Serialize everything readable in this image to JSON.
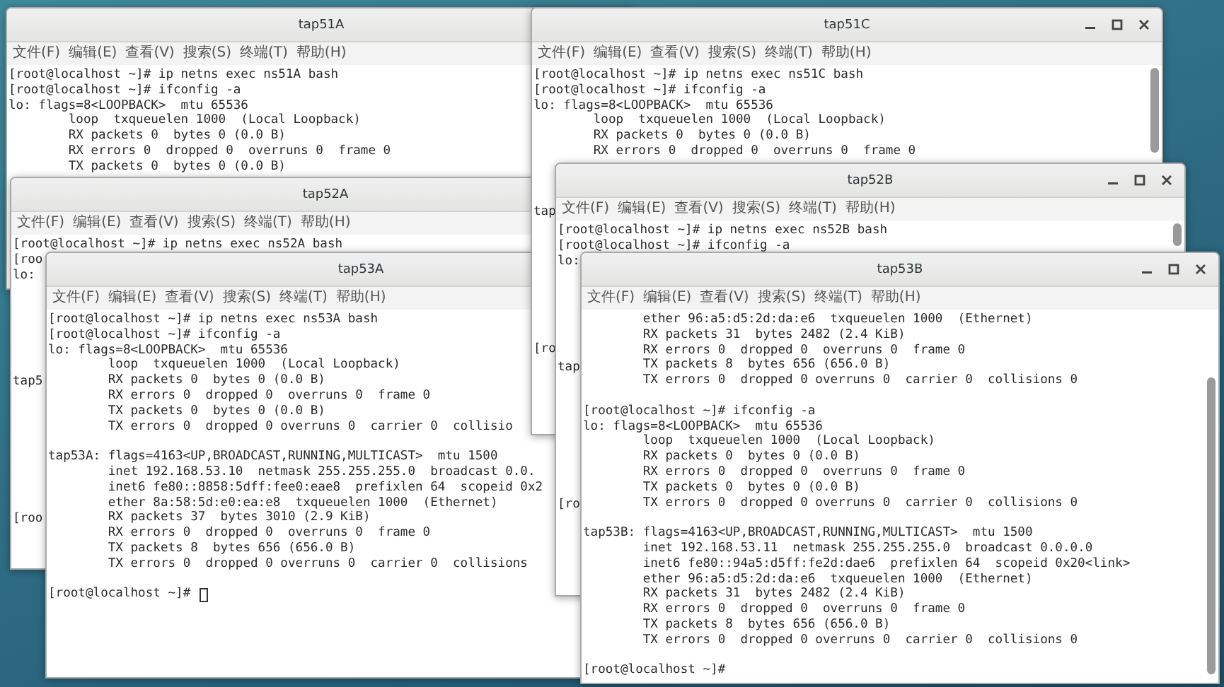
{
  "desktop": {
    "windows": [
      {
        "title": "tap51A",
        "menu": [
          "文件(F)",
          "编辑(E)",
          "查看(V)",
          "搜索(S)",
          "终端(T)",
          "帮助(H)"
        ],
        "lines": [
          {
            "kind": "text",
            "text": "[root@localhost ~]# ip netns exec ns51A bash"
          },
          {
            "kind": "text",
            "text": "[root@localhost ~]# ifconfig -a"
          },
          {
            "kind": "text",
            "text": "lo: flags=8<LOOPBACK>  mtu 65536"
          },
          {
            "kind": "text",
            "text": "        loop  txqueuelen 1000  (Local Loopback)"
          },
          {
            "kind": "text",
            "text": "        RX packets 0  bytes 0 (0.0 B)"
          },
          {
            "kind": "text",
            "text": "        RX errors 0  dropped 0  overruns 0  frame 0"
          },
          {
            "kind": "text",
            "text": "        TX packets 0  bytes 0 (0.0 B)"
          }
        ]
      },
      {
        "title": "tap51C",
        "window_buttons": true,
        "menu": [
          "文件(F)",
          "编辑(E)",
          "查看(V)",
          "搜索(S)",
          "终端(T)",
          "帮助(H)"
        ],
        "lines": [
          {
            "kind": "text",
            "text": "[root@localhost ~]# ip netns exec ns51C bash"
          },
          {
            "kind": "text",
            "text": "[root@localhost ~]# ifconfig -a"
          },
          {
            "kind": "text",
            "text": "lo: flags=8<LOOPBACK>  mtu 65536"
          },
          {
            "kind": "text",
            "text": "        loop  txqueuelen 1000  (Local Loopback)"
          },
          {
            "kind": "text",
            "text": "        RX packets 0  bytes 0 (0.0 B)"
          },
          {
            "kind": "text",
            "text": "        RX errors 0  dropped 0  overruns 0  frame 0"
          },
          {
            "kind": "blank"
          },
          {
            "kind": "blank"
          },
          {
            "kind": "blank"
          },
          {
            "kind": "text",
            "text": "tap"
          },
          {
            "kind": "blank"
          },
          {
            "kind": "blank"
          },
          {
            "kind": "blank"
          },
          {
            "kind": "blank"
          },
          {
            "kind": "blank"
          },
          {
            "kind": "blank"
          },
          {
            "kind": "blank"
          },
          {
            "kind": "blank"
          },
          {
            "kind": "text",
            "text": "[ro"
          }
        ]
      },
      {
        "title": "tap52A",
        "menu": [
          "文件(F)",
          "编辑(E)",
          "查看(V)",
          "搜索(S)",
          "终端(T)",
          "帮助(H)"
        ],
        "lines": [
          {
            "kind": "text",
            "text": "[root@localhost ~]# ip netns exec ns52A bash"
          },
          {
            "kind": "text",
            "text": "[roo"
          },
          {
            "kind": "text",
            "text": "lo:"
          },
          {
            "kind": "blank"
          },
          {
            "kind": "blank"
          },
          {
            "kind": "blank"
          },
          {
            "kind": "blank"
          },
          {
            "kind": "blank"
          },
          {
            "kind": "blank"
          },
          {
            "kind": "text",
            "text": "tap5"
          },
          {
            "kind": "blank"
          },
          {
            "kind": "blank"
          },
          {
            "kind": "blank"
          },
          {
            "kind": "blank"
          },
          {
            "kind": "blank"
          },
          {
            "kind": "blank"
          },
          {
            "kind": "blank"
          },
          {
            "kind": "blank"
          },
          {
            "kind": "text",
            "text": "[roo"
          }
        ]
      },
      {
        "title": "tap52B",
        "window_buttons": true,
        "menu": [
          "文件(F)",
          "编辑(E)",
          "查看(V)",
          "搜索(S)",
          "终端(T)",
          "帮助(H)"
        ],
        "lines": [
          {
            "kind": "text",
            "text": "[root@localhost ~]# ip netns exec ns52B bash"
          },
          {
            "kind": "text",
            "text": "[root@localhost ~]# ifconfig -a"
          },
          {
            "kind": "text",
            "text": "lo:"
          },
          {
            "kind": "blank"
          },
          {
            "kind": "blank"
          },
          {
            "kind": "blank"
          },
          {
            "kind": "blank"
          },
          {
            "kind": "blank"
          },
          {
            "kind": "blank"
          },
          {
            "kind": "text",
            "text": "tap"
          },
          {
            "kind": "blank"
          },
          {
            "kind": "blank"
          },
          {
            "kind": "blank"
          },
          {
            "kind": "blank"
          },
          {
            "kind": "blank"
          },
          {
            "kind": "blank"
          },
          {
            "kind": "blank"
          },
          {
            "kind": "blank"
          },
          {
            "kind": "text",
            "text": "[ro"
          }
        ]
      },
      {
        "title": "tap53A",
        "cursor": true,
        "menu": [
          "文件(F)",
          "编辑(E)",
          "查看(V)",
          "搜索(S)",
          "终端(T)",
          "帮助(H)"
        ],
        "lines": [
          {
            "kind": "text",
            "text": "[root@localhost ~]# ip netns exec ns53A bash"
          },
          {
            "kind": "text",
            "text": "[root@localhost ~]# ifconfig -a"
          },
          {
            "kind": "text",
            "text": "lo: flags=8<LOOPBACK>  mtu 65536"
          },
          {
            "kind": "text",
            "text": "        loop  txqueuelen 1000  (Local Loopback)"
          },
          {
            "kind": "text",
            "text": "        RX packets 0  bytes 0 (0.0 B)"
          },
          {
            "kind": "text",
            "text": "        RX errors 0  dropped 0  overruns 0  frame 0"
          },
          {
            "kind": "text",
            "text": "        TX packets 0  bytes 0 (0.0 B)"
          },
          {
            "kind": "text",
            "text": "        TX errors 0  dropped 0 overruns 0  carrier 0  collisio"
          },
          {
            "kind": "blank"
          },
          {
            "kind": "text",
            "text": "tap53A: flags=4163<UP,BROADCAST,RUNNING,MULTICAST>  mtu 1500"
          },
          {
            "kind": "text",
            "text": "        inet 192.168.53.10  netmask 255.255.255.0  broadcast 0.0."
          },
          {
            "kind": "text",
            "text": "        inet6 fe80::8858:5dff:fee0:eae8  prefixlen 64  scopeid 0x2"
          },
          {
            "kind": "text",
            "text": "        ether 8a:58:5d:e0:ea:e8  txqueuelen 1000  (Ethernet)"
          },
          {
            "kind": "text",
            "text": "        RX packets 37  bytes 3010 (2.9 KiB)"
          },
          {
            "kind": "text",
            "text": "        RX errors 0  dropped 0  overruns 0  frame 0"
          },
          {
            "kind": "text",
            "text": "        TX packets 8  bytes 656 (656.0 B)"
          },
          {
            "kind": "text",
            "text": "        TX errors 0  dropped 0 overruns 0  carrier 0  collisions"
          },
          {
            "kind": "blank"
          },
          {
            "kind": "text",
            "text": "[root@localhost ~]#"
          }
        ]
      },
      {
        "title": "tap53B",
        "window_buttons": true,
        "menu": [
          "文件(F)",
          "编辑(E)",
          "查看(V)",
          "搜索(S)",
          "终端(T)",
          "帮助(H)"
        ],
        "lines": [
          {
            "kind": "text",
            "text": "        ether 96:a5:d5:2d:da:e6  txqueuelen 1000  (Ethernet)"
          },
          {
            "kind": "text",
            "text": "        RX packets 31  bytes 2482 (2.4 KiB)"
          },
          {
            "kind": "text",
            "text": "        RX errors 0  dropped 0  overruns 0  frame 0"
          },
          {
            "kind": "text",
            "text": "        TX packets 8  bytes 656 (656.0 B)"
          },
          {
            "kind": "text",
            "text": "        TX errors 0  dropped 0 overruns 0  carrier 0  collisions 0"
          },
          {
            "kind": "blank"
          },
          {
            "kind": "text",
            "text": "[root@localhost ~]# ifconfig -a"
          },
          {
            "kind": "text",
            "text": "lo: flags=8<LOOPBACK>  mtu 65536"
          },
          {
            "kind": "text",
            "text": "        loop  txqueuelen 1000  (Local Loopback)"
          },
          {
            "kind": "text",
            "text": "        RX packets 0  bytes 0 (0.0 B)"
          },
          {
            "kind": "text",
            "text": "        RX errors 0  dropped 0  overruns 0  frame 0"
          },
          {
            "kind": "text",
            "text": "        TX packets 0  bytes 0 (0.0 B)"
          },
          {
            "kind": "text",
            "text": "        TX errors 0  dropped 0 overruns 0  carrier 0  collisions 0"
          },
          {
            "kind": "blank"
          },
          {
            "kind": "text",
            "text": "tap53B: flags=4163<UP,BROADCAST,RUNNING,MULTICAST>  mtu 1500"
          },
          {
            "kind": "text",
            "text": "        inet 192.168.53.11  netmask 255.255.255.0  broadcast 0.0.0.0"
          },
          {
            "kind": "text",
            "text": "        inet6 fe80::94a5:d5ff:fe2d:dae6  prefixlen 64  scopeid 0x20<link>"
          },
          {
            "kind": "text",
            "text": "        ether 96:a5:d5:2d:da:e6  txqueuelen 1000  (Ethernet)"
          },
          {
            "kind": "text",
            "text": "        RX packets 31  bytes 2482 (2.4 KiB)"
          },
          {
            "kind": "text",
            "text": "        RX errors 0  dropped 0  overruns 0  frame 0"
          },
          {
            "kind": "text",
            "text": "        TX packets 8  bytes 656 (656.0 B)"
          },
          {
            "kind": "text",
            "text": "        TX errors 0  dropped 0 overruns 0  carrier 0  collisions 0"
          },
          {
            "kind": "blank"
          },
          {
            "kind": "text",
            "text": "[root@localhost ~]#"
          }
        ]
      }
    ]
  }
}
